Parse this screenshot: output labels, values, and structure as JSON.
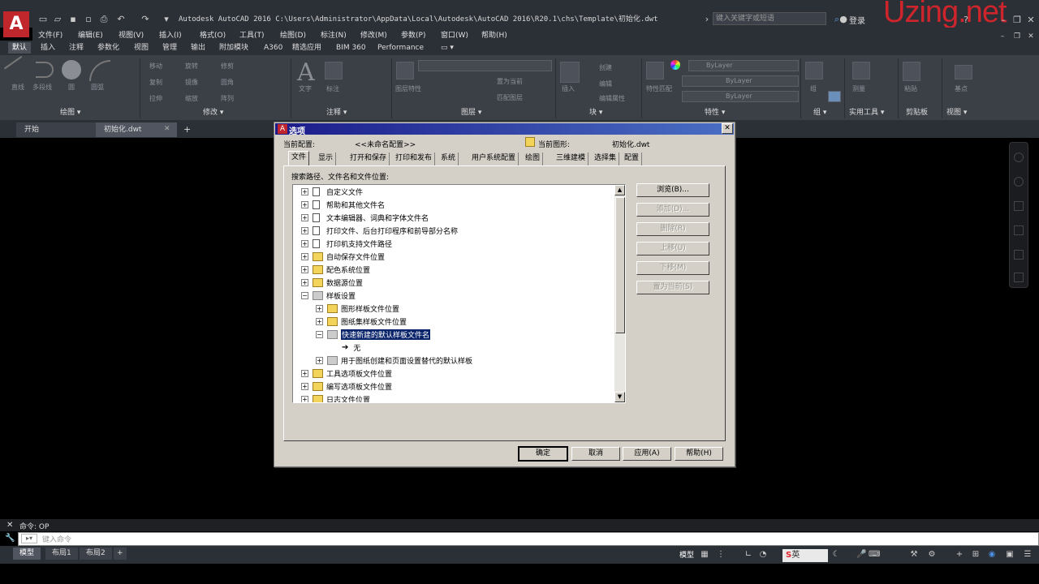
{
  "app": {
    "title": "Autodesk AutoCAD 2016    C:\\Users\\Administrator\\AppData\\Local\\Autodesk\\AutoCAD 2016\\R20.1\\chs\\Template\\初始化.dwt",
    "search_placeholder": "键入关键字或短语",
    "login_label": "登录",
    "watermark": "Uzing.net",
    "logo_letter": "A"
  },
  "menu": [
    "文件(F)",
    "编辑(E)",
    "视图(V)",
    "插入(I)",
    "格式(O)",
    "工具(T)",
    "绘图(D)",
    "标注(N)",
    "修改(M)",
    "参数(P)",
    "窗口(W)",
    "帮助(H)"
  ],
  "ribbon_tabs": [
    "默认",
    "插入",
    "注释",
    "参数化",
    "视图",
    "管理",
    "输出",
    "附加模块",
    "A360",
    "精选应用",
    "BIM 360",
    "Performance"
  ],
  "ribbon_panels": [
    "绘图 ▾",
    "修改 ▾",
    "注释 ▾",
    "图层 ▾",
    "块 ▾",
    "特性 ▾",
    "组 ▾",
    "实用工具 ▾",
    "剪贴板",
    "视图 ▾"
  ],
  "ribbon_tools": {
    "draw": [
      "直线",
      "多段线",
      "圆",
      "圆弧"
    ],
    "modify": [
      "移动",
      "旋转",
      "修剪",
      "复制",
      "镜像",
      "圆角",
      "拉伸",
      "缩放",
      "阵列"
    ],
    "annotation": [
      "文字",
      "标注"
    ],
    "layers": [
      "图层特性",
      "置为当前",
      "匹配图层"
    ],
    "block": [
      "插入",
      "创建",
      "编辑",
      "编辑属性"
    ],
    "properties": [
      "ByLayer",
      "ByLayer",
      "ByLayer",
      "特性匹配"
    ],
    "groups": [
      "组"
    ],
    "utilities": [
      "测量"
    ],
    "clipboard": [
      "粘贴"
    ],
    "view": [
      "基点"
    ]
  },
  "doc_tabs": [
    "开始",
    "初始化.dwt"
  ],
  "command": {
    "history": "命令: OP",
    "input_placeholder": "键入命令"
  },
  "layout_tabs": [
    "模型",
    "布局1",
    "布局2"
  ],
  "status": {
    "model": "模型",
    "ime": "英"
  },
  "dialog": {
    "title": "选项",
    "current_profile_label": "当前配置:",
    "current_profile_value": "<<未命名配置>>",
    "current_drawing_label": "当前图形:",
    "current_drawing_value": "初始化.dwt",
    "tabs": [
      "文件",
      "显示",
      "打开和保存",
      "打印和发布",
      "系统",
      "用户系统配置",
      "绘图",
      "三维建模",
      "选择集",
      "配置"
    ],
    "section_label": "搜索路径、文件名和文件位置:",
    "tree": [
      {
        "label": "自定义文件",
        "icon": "file",
        "level": 0,
        "exp": "+"
      },
      {
        "label": "帮助和其他文件名",
        "icon": "file",
        "level": 0,
        "exp": "+"
      },
      {
        "label": "文本编辑器、词典和字体文件名",
        "icon": "file",
        "level": 0,
        "exp": "+"
      },
      {
        "label": "打印文件、后台打印程序和前导部分名称",
        "icon": "file",
        "level": 0,
        "exp": "+"
      },
      {
        "label": "打印机支持文件路径",
        "icon": "file",
        "level": 0,
        "exp": "+"
      },
      {
        "label": "自动保存文件位置",
        "icon": "folder",
        "level": 0,
        "exp": "+"
      },
      {
        "label": "配色系统位置",
        "icon": "folder",
        "level": 0,
        "exp": "+"
      },
      {
        "label": "数据源位置",
        "icon": "folder",
        "level": 0,
        "exp": "+"
      },
      {
        "label": "样板设置",
        "icon": "tpl",
        "level": 0,
        "exp": "-"
      },
      {
        "label": "图形样板文件位置",
        "icon": "folder",
        "level": 1,
        "exp": "+"
      },
      {
        "label": "图纸集样板文件位置",
        "icon": "folder",
        "level": 1,
        "exp": "+"
      },
      {
        "label": "快速新建的默认样板文件名",
        "icon": "tpl",
        "level": 1,
        "exp": "-",
        "selected": true
      },
      {
        "label": "无",
        "icon": "arrow",
        "level": 2,
        "exp": ""
      },
      {
        "label": "用于图纸创建和页面设置替代的默认样板",
        "icon": "tpl",
        "level": 1,
        "exp": "+"
      },
      {
        "label": "工具选项板文件位置",
        "icon": "folder",
        "level": 0,
        "exp": "+"
      },
      {
        "label": "编写选项板文件位置",
        "icon": "folder",
        "level": 0,
        "exp": "+"
      },
      {
        "label": "日志文件位置",
        "icon": "folder",
        "level": 0,
        "exp": "+"
      }
    ],
    "side_buttons": [
      {
        "label": "浏览(B)...",
        "enabled": true
      },
      {
        "label": "添加(D)...",
        "enabled": false
      },
      {
        "label": "删除(R)",
        "enabled": false
      },
      {
        "label": "上移(U)",
        "enabled": false
      },
      {
        "label": "下移(M)",
        "enabled": false
      },
      {
        "label": "置为当前(S)",
        "enabled": false
      }
    ],
    "footer_buttons": [
      "确定",
      "取消",
      "应用(A)",
      "帮助(H)"
    ]
  },
  "colors": {
    "autocad_red": "#c0272d",
    "selection": "#0a246a",
    "dialog_face": "#d4d0c8"
  }
}
